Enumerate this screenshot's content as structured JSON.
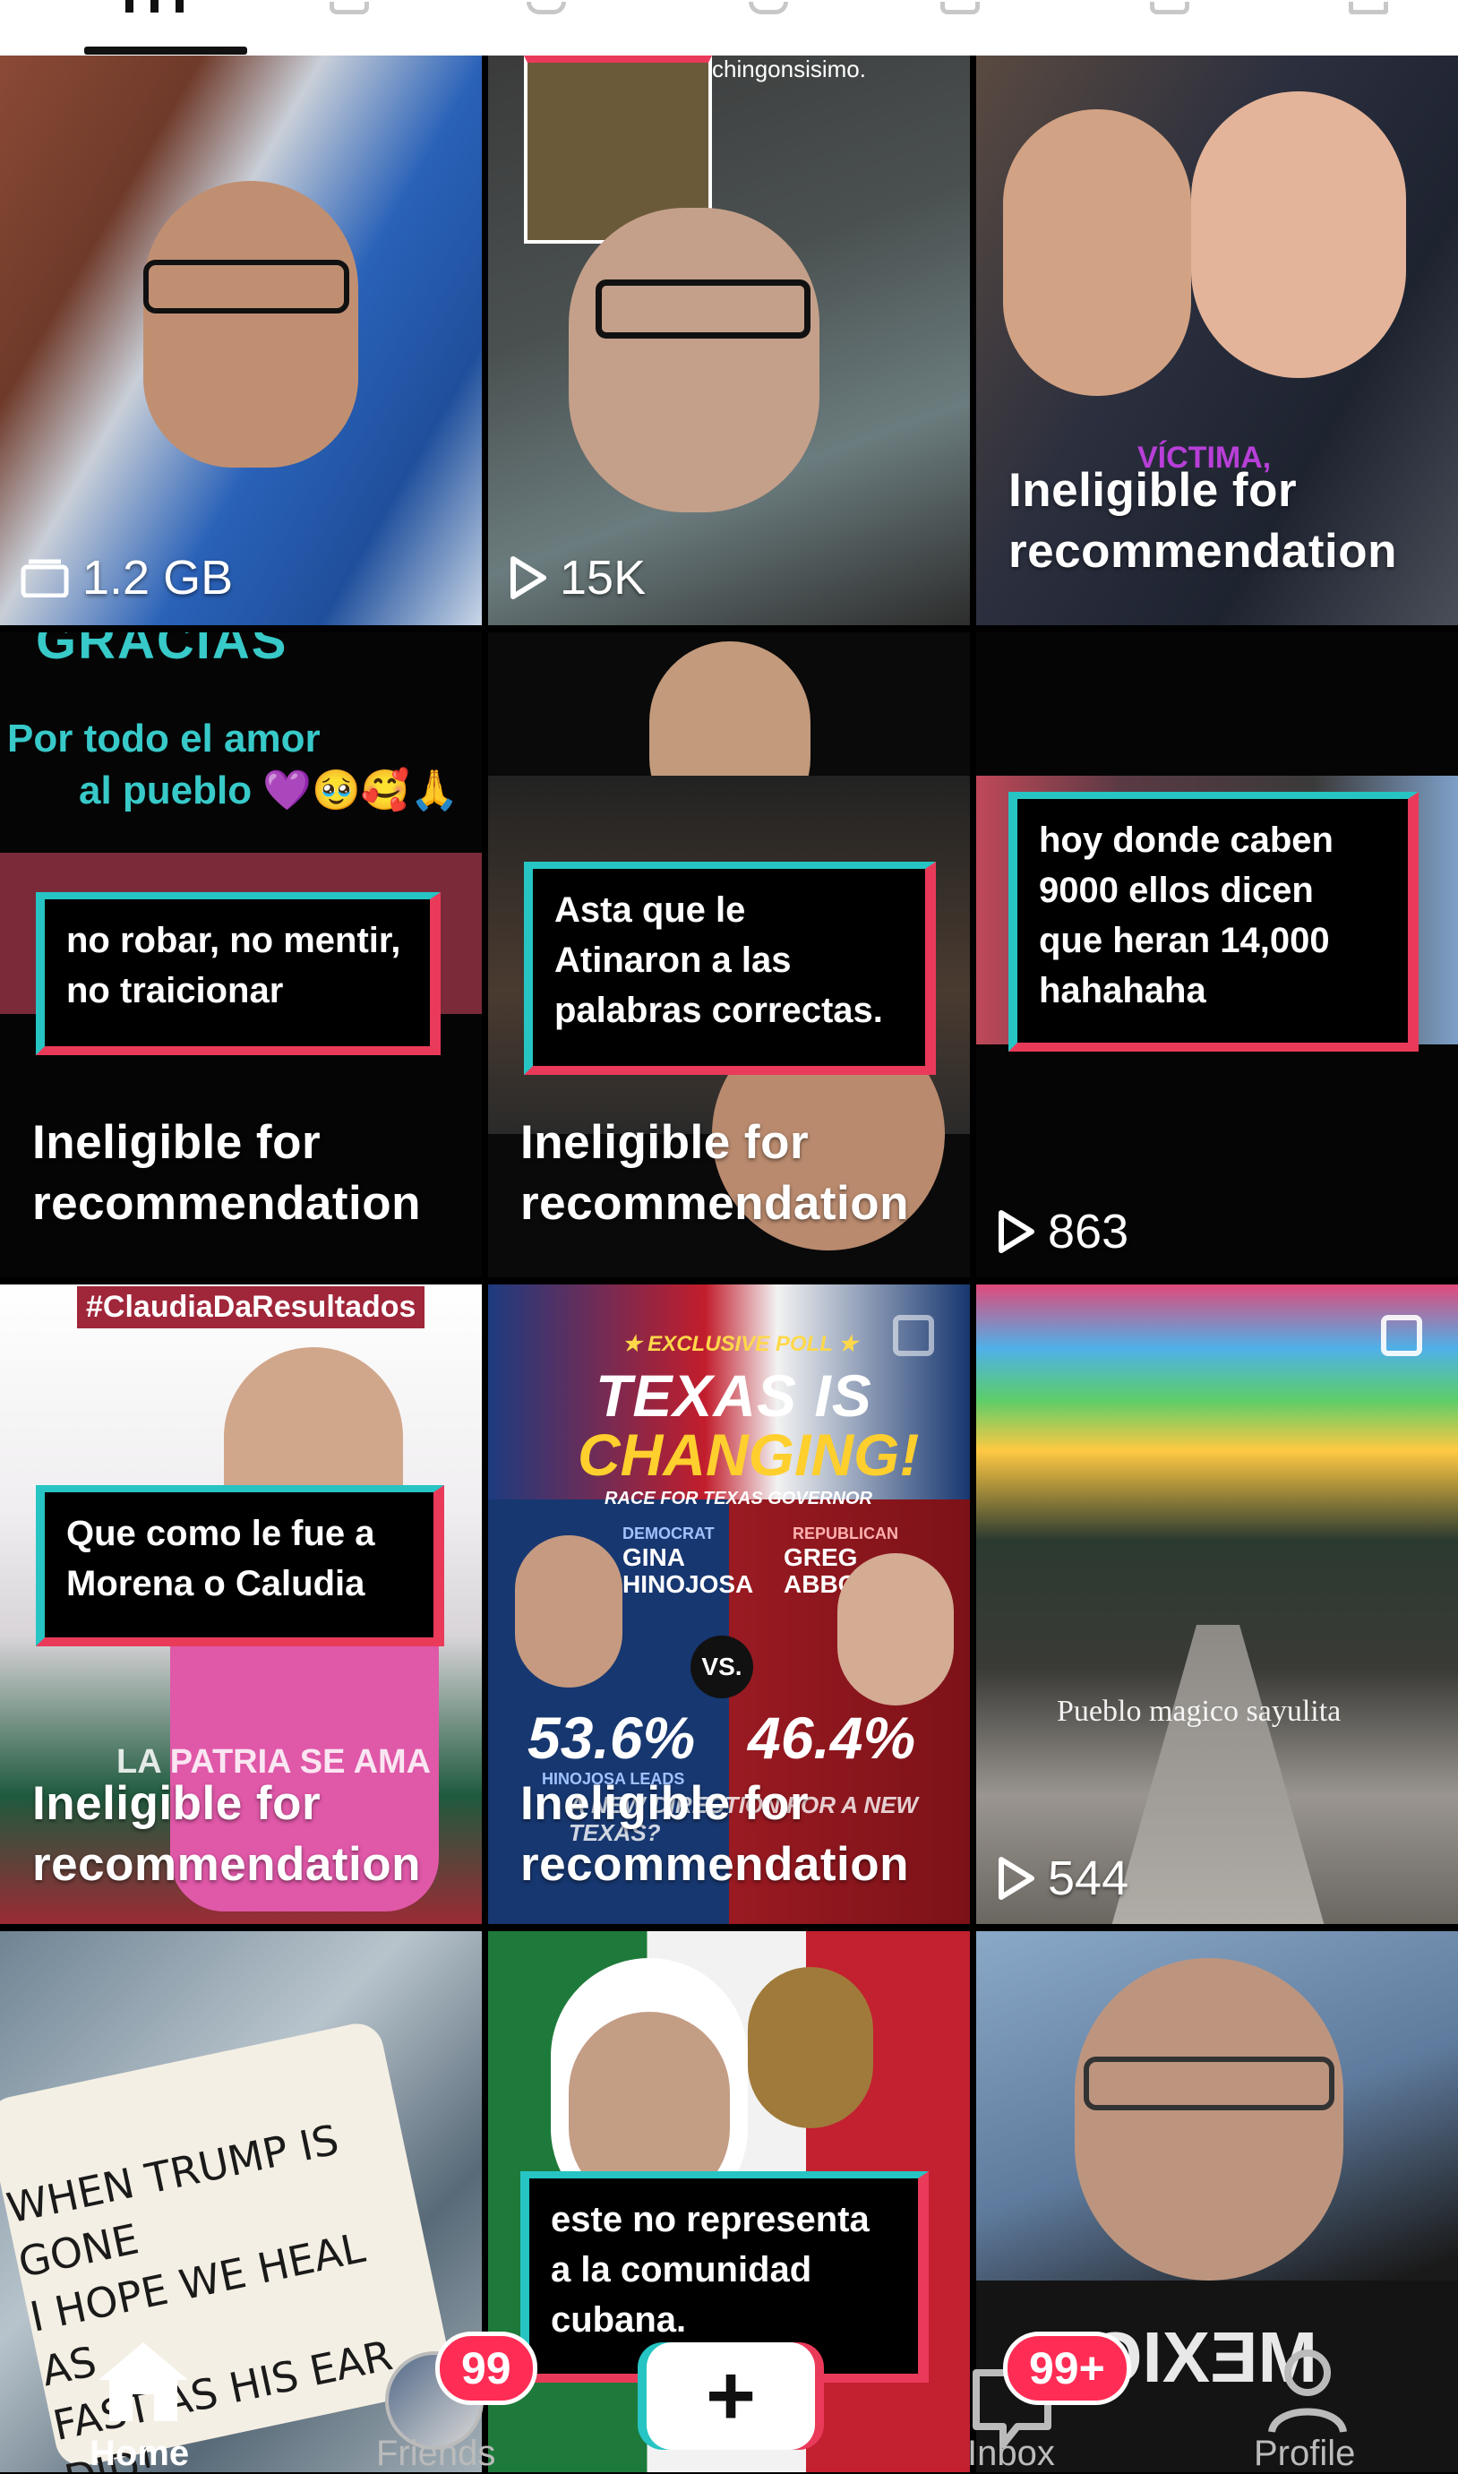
{
  "grid": {
    "items": [
      {
        "kind": "drafts",
        "stat": "1.2 GB",
        "stat_icon": "folder-icon"
      },
      {
        "kind": "video",
        "stat": "15K",
        "stat_icon": "play-icon",
        "overlay_text": "chingonsisimo."
      },
      {
        "kind": "ineligible",
        "caption_lines": [
          "Ineligible for",
          "recommendation"
        ],
        "overlay_text": "VÍCTIMA,"
      },
      {
        "kind": "ineligible",
        "caption_lines": [
          "Ineligible for",
          "recommendation"
        ],
        "headline": "GRACIAS",
        "sub_lines": [
          "Por todo el amor",
          "al pueblo 💜🥹🥰🙏"
        ],
        "callout_lines": [
          "no robar, no mentir,",
          "no traicionar"
        ]
      },
      {
        "kind": "ineligible",
        "caption_lines": [
          "Ineligible for",
          "recommendation"
        ],
        "callout_lines": [
          "Asta que le",
          "Atinaron a las",
          "palabras correctas."
        ]
      },
      {
        "kind": "video",
        "stat": "863",
        "stat_icon": "play-icon",
        "callout_lines": [
          "hoy donde caben",
          "9000 ellos dicen",
          "que heran 14,000",
          "hahahaha"
        ]
      },
      {
        "kind": "ineligible",
        "caption_lines": [
          "Ineligible for",
          "recommendation"
        ],
        "hashtag": "#ClaudiaDaResultados",
        "callout_lines": [
          "Que como le fue a",
          "Morena o Caludia"
        ],
        "footer_text": "LA PATRIA SE AMA"
      },
      {
        "kind": "ineligible",
        "caption_lines": [
          "Ineligible for",
          "recommendation"
        ],
        "poll": {
          "tag": "★ EXCLUSIVE POLL ★",
          "title1": "TEXAS IS",
          "title2": "CHANGING!",
          "subtitle": "RACE FOR TEXAS GOVERNOR",
          "left_party": "DEMOCRAT",
          "left_name": "GINA HINOJOSA",
          "left_pct": "53.6%",
          "left_note": "HINOJOSA LEADS",
          "vs": "VS.",
          "right_party": "REPUBLICAN",
          "right_name": "GREG ABBOTT",
          "right_pct": "46.4%",
          "question": "A NEW DIRECTION FOR A NEW TEXAS?"
        }
      },
      {
        "kind": "video",
        "stat": "544",
        "stat_icon": "play-icon",
        "overlay_text": "Pueblo magico sayulita"
      },
      {
        "kind": "ineligible",
        "caption_lines": [
          "Ineligible for"
        ],
        "cookie_lines": [
          "WHEN TRUMP IS GONE",
          "I HOPE WE HEAL AS",
          "FAST AS HIS EAR DID!"
        ]
      },
      {
        "kind": "video",
        "callout_lines": [
          "este no representa",
          "a la comunidad",
          "cubana."
        ]
      },
      {
        "kind": "video",
        "shirt_text": "MEXICA"
      }
    ]
  },
  "bottom_nav": {
    "home_label": "Home",
    "friends_label": "Friends",
    "friends_badge": "99",
    "inbox_label": "Inbox",
    "inbox_badge": "99+",
    "profile_label": "Profile",
    "create_label": "+"
  },
  "colors": {
    "accent_cyan": "#27c4c4",
    "accent_red": "#ea3a5a",
    "badge": "#ff2d55"
  }
}
